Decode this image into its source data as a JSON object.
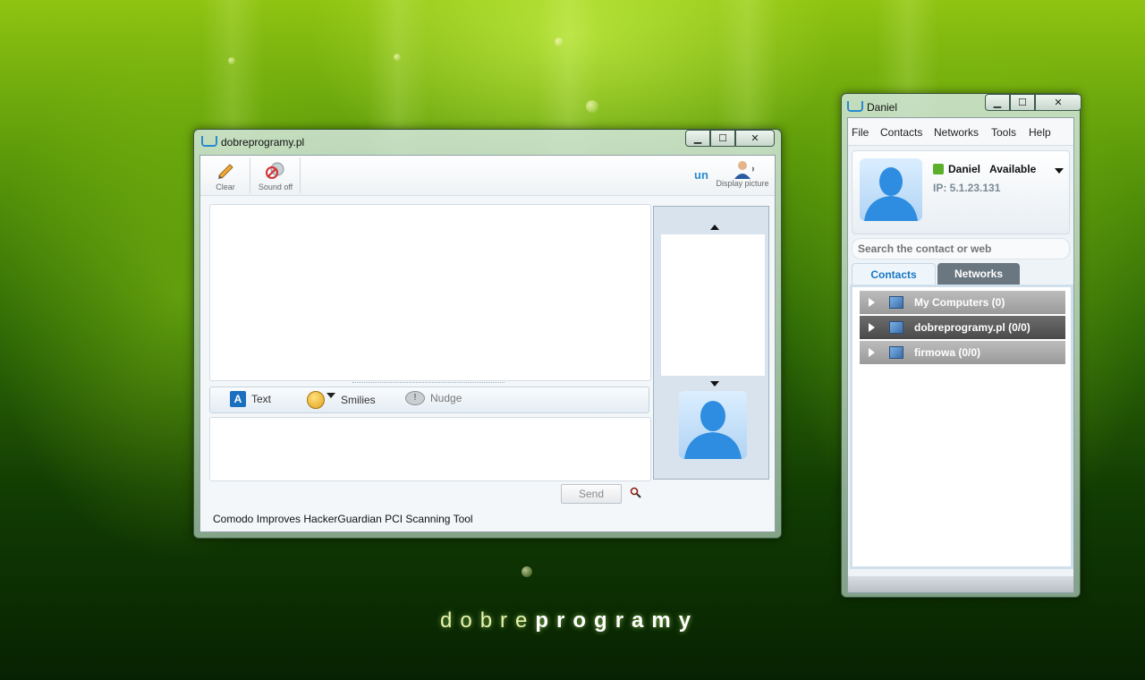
{
  "desktop": {
    "brand_light": "dobre",
    "brand_bold": "programy"
  },
  "chat_window": {
    "title": "dobreprogramy.pl",
    "toolbar": {
      "clear_label": "Clear",
      "sound_label": "Sound off",
      "display_picture_label": "Display picture"
    },
    "format": {
      "text_label": "Text",
      "smilies_label": "Smilies",
      "nudge_label": "Nudge"
    },
    "send_label": "Send",
    "status_text": "Comodo Improves HackerGuardian PCI Scanning Tool"
  },
  "contact_window": {
    "title": "Daniel",
    "menu": [
      "File",
      "Contacts",
      "Networks",
      "Tools",
      "Help"
    ],
    "user": {
      "name": "Daniel",
      "status": "Available",
      "ip": "IP: 5.1.23.131"
    },
    "search": {
      "placeholder": "Search the contact or web"
    },
    "tabs": [
      "Contacts",
      "Networks"
    ],
    "groups": [
      {
        "label": "My Computers (0)"
      },
      {
        "label": "dobreprogramy.pl (0/0)"
      },
      {
        "label": "firmowa (0/0)"
      }
    ]
  },
  "colors": {
    "accent": "#1a78c2",
    "selected_group": "#5a5a5a",
    "group_gray": "#a8a8a8"
  }
}
